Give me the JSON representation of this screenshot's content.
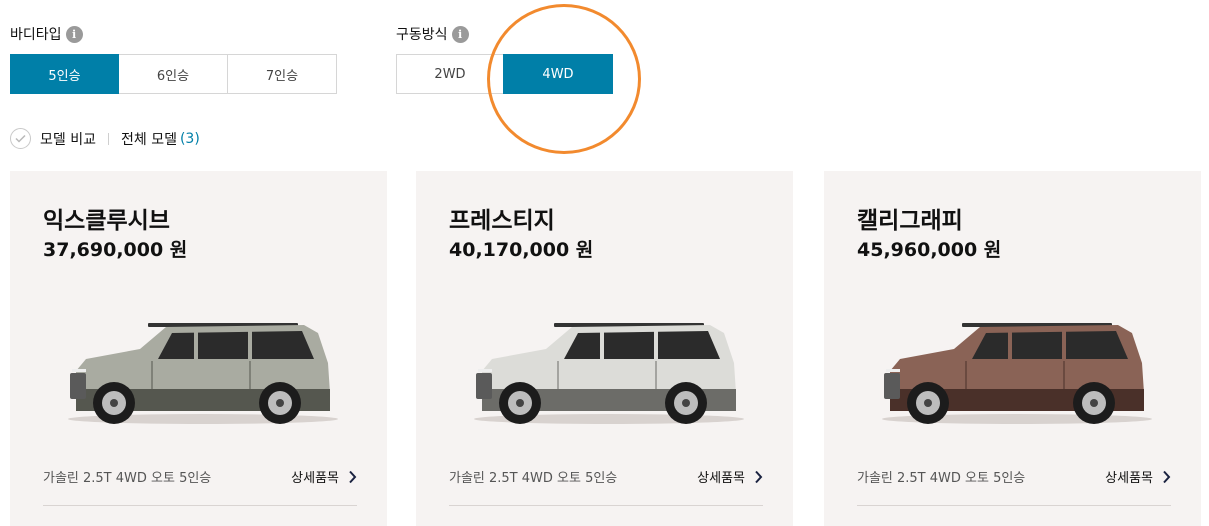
{
  "body_type": {
    "label": "바디타입",
    "info_glyph": "i",
    "options": [
      "5인승",
      "6인승",
      "7인승"
    ],
    "selected": "5인승"
  },
  "drive_type": {
    "label": "구동방식",
    "info_glyph": "i",
    "options": [
      "2WD",
      "4WD"
    ],
    "selected": "4WD"
  },
  "compare": {
    "compare_label": "모델 비교",
    "all_models_label": "전체 모델",
    "count": "(3)"
  },
  "colors": {
    "accent": "#007fa8",
    "highlight_ring": "#f28a2e",
    "card_bg": "#f6f3f2"
  },
  "models": [
    {
      "name": "익스클루시브",
      "price": "37,690,000 원",
      "trim": "가솔린 2.5T 4WD 오토 5인승",
      "detail_label": "상세품목",
      "body_color": "#a9aba1",
      "dark_color": "#55574f"
    },
    {
      "name": "프레스티지",
      "price": "40,170,000 원",
      "trim": "가솔린 2.5T 4WD 오토 5인승",
      "detail_label": "상세품목",
      "body_color": "#dcdcd8",
      "dark_color": "#6c6c68"
    },
    {
      "name": "캘리그래피",
      "price": "45,960,000 원",
      "trim": "가솔린 2.5T 4WD 오토 5인승",
      "detail_label": "상세품목",
      "body_color": "#8a6356",
      "dark_color": "#4a3029"
    }
  ]
}
